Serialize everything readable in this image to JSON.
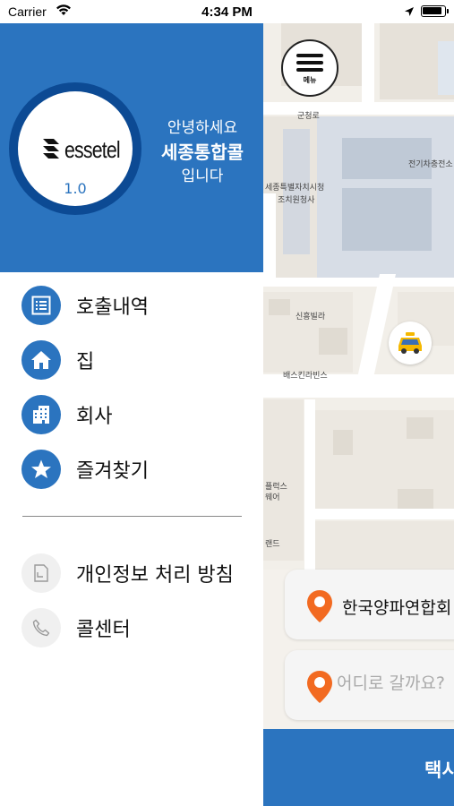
{
  "status_bar": {
    "carrier": "Carrier",
    "time": "4:34 PM"
  },
  "drawer": {
    "app_version": "1.0",
    "logo_text": "essetel",
    "greeting": {
      "line1": "안녕하세요",
      "line2": "세종통합콜",
      "line3": "입니다"
    },
    "menu_items": [
      {
        "label": "호출내역",
        "icon": "list-icon"
      },
      {
        "label": "집",
        "icon": "home-icon"
      },
      {
        "label": "회사",
        "icon": "building-icon"
      },
      {
        "label": "즐겨찾기",
        "icon": "star-icon"
      }
    ],
    "secondary_items": [
      {
        "label": "개인정보 처리 방침",
        "icon": "document-icon"
      },
      {
        "label": "콜센터",
        "icon": "phone-icon"
      }
    ]
  },
  "map": {
    "menu_button_label": "메뉴",
    "labels": {
      "road_top": "군청로",
      "charging_station": "전기차충전소",
      "gov_office": "세종특별자치시청",
      "gov_office2": "조치원청사",
      "villa": "신흥빌라",
      "baskin": "배스킨라빈스",
      "mart1": "플럭스",
      "mart2": "웨어",
      "brand": "랜드"
    },
    "origin_address": "한국양파연합회",
    "destination_placeholder": "어디로 갈까요?",
    "call_button_label": "택시"
  },
  "colors": {
    "primary": "#2b74bf",
    "dark_ring": "#0c4a94",
    "pin": "#f26a21",
    "taxi": "#f5b800"
  }
}
